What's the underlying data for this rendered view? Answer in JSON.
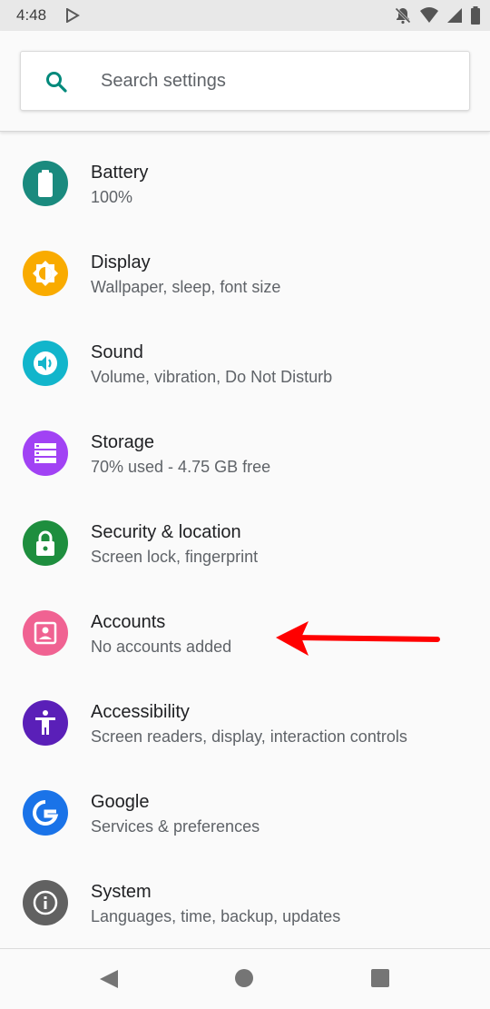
{
  "status_bar": {
    "time": "4:48",
    "icons": [
      "play-store-icon",
      "notifications-off-icon",
      "wifi-icon",
      "cell-signal-icon",
      "battery-icon"
    ]
  },
  "search": {
    "placeholder": "Search settings",
    "icon": "search-icon",
    "icon_color": "#00897b"
  },
  "settings": [
    {
      "title": "Battery",
      "subtitle": "100%",
      "icon": "battery-icon",
      "color": "#1a8a7e"
    },
    {
      "title": "Display",
      "subtitle": "Wallpaper, sleep, font size",
      "icon": "brightness-icon",
      "color": "#f9ab00"
    },
    {
      "title": "Sound",
      "subtitle": "Volume, vibration, Do Not Disturb",
      "icon": "volume-icon",
      "color": "#12b5cb"
    },
    {
      "title": "Storage",
      "subtitle": "70% used - 4.75 GB free",
      "icon": "storage-icon",
      "color": "#a142f4"
    },
    {
      "title": "Security & location",
      "subtitle": "Screen lock, fingerprint",
      "icon": "lock-icon",
      "color": "#1e8e3e"
    },
    {
      "title": "Accounts",
      "subtitle": "No accounts added",
      "icon": "account-box-icon",
      "color": "#f06292"
    },
    {
      "title": "Accessibility",
      "subtitle": "Screen readers, display, interaction controls",
      "icon": "accessibility-icon",
      "color": "#5a1fb8"
    },
    {
      "title": "Google",
      "subtitle": "Services & preferences",
      "icon": "google-icon",
      "color": "#1a73e8"
    },
    {
      "title": "System",
      "subtitle": "Languages, time, backup, updates",
      "icon": "info-icon",
      "color": "#616161"
    }
  ],
  "annotation": {
    "icon": "red-arrow-icon",
    "color": "#ff0000",
    "points_to": "Accounts"
  },
  "nav_bar": {
    "buttons": [
      "back-icon",
      "home-icon",
      "recent-apps-icon"
    ],
    "color": "#757575"
  }
}
